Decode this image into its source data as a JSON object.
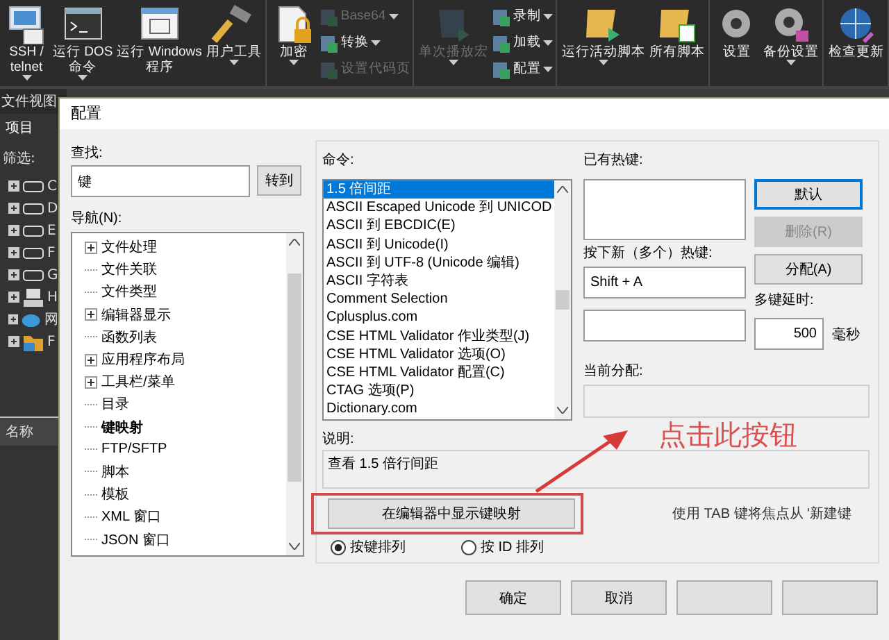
{
  "toolbar": {
    "groups": [
      {
        "items": [
          {
            "kind": "large",
            "label": "SSH /\ntelnet",
            "dropdown": true,
            "disabled": false
          },
          {
            "kind": "large",
            "label": "运行 DOS\n命令",
            "dropdown": true,
            "disabled": false
          },
          {
            "kind": "large",
            "label": "运行 Windows\n程序",
            "dropdown": false,
            "disabled": false
          },
          {
            "kind": "large",
            "label": "用户工具",
            "dropdown": true,
            "disabled": false
          }
        ]
      },
      {
        "items": [
          {
            "kind": "large",
            "label": "加密",
            "dropdown": true,
            "disabled": false
          },
          {
            "kind": "small",
            "label": "Base64",
            "dropdown": true,
            "disabled": true
          },
          {
            "kind": "small",
            "label": "转换",
            "dropdown": true,
            "disabled": false
          },
          {
            "kind": "small",
            "label": "设置代码页",
            "dropdown": false,
            "disabled": true
          }
        ]
      },
      {
        "items": [
          {
            "kind": "large",
            "label": "单次播放宏",
            "dropdown": true,
            "disabled": true
          },
          {
            "kind": "small",
            "label": "录制",
            "dropdown": true,
            "disabled": false
          },
          {
            "kind": "small",
            "label": "加载",
            "dropdown": true,
            "disabled": false
          },
          {
            "kind": "small",
            "label": "配置",
            "dropdown": true,
            "disabled": false
          }
        ]
      },
      {
        "items": [
          {
            "kind": "large",
            "label": "运行活动脚本",
            "dropdown": true,
            "disabled": false
          },
          {
            "kind": "large",
            "label": "所有脚本",
            "dropdown": false,
            "disabled": false
          }
        ]
      },
      {
        "items": [
          {
            "kind": "large",
            "label": "设置",
            "dropdown": false,
            "disabled": false
          },
          {
            "kind": "large",
            "label": "备份设置",
            "dropdown": true,
            "disabled": false
          }
        ]
      },
      {
        "items": [
          {
            "kind": "large",
            "label": "检查更新",
            "dropdown": false,
            "disabled": false
          }
        ]
      }
    ]
  },
  "file_view": {
    "title": "文件视图",
    "tab": "项目",
    "filter_label": "筛选:",
    "drives": [
      {
        "kind": "drive",
        "label": "C"
      },
      {
        "kind": "drive",
        "label": "D"
      },
      {
        "kind": "drive",
        "label": "E"
      },
      {
        "kind": "drive",
        "label": "F"
      },
      {
        "kind": "drive",
        "label": "G"
      },
      {
        "kind": "network",
        "label": "H"
      },
      {
        "kind": "cloud",
        "label": "网"
      },
      {
        "kind": "folder",
        "label": "F"
      }
    ],
    "column_header": "名称"
  },
  "dialog": {
    "title": "配置",
    "find": {
      "label": "查找:",
      "value": "键",
      "button": "转到"
    },
    "nav": {
      "label": "导航(N):",
      "items": [
        {
          "label": "文件处理",
          "expandable": true,
          "selected": false
        },
        {
          "label": "文件关联",
          "expandable": false,
          "selected": false
        },
        {
          "label": "文件类型",
          "expandable": false,
          "selected": false
        },
        {
          "label": "编辑器显示",
          "expandable": true,
          "selected": false
        },
        {
          "label": "函数列表",
          "expandable": false,
          "selected": false
        },
        {
          "label": "应用程序布局",
          "expandable": true,
          "selected": false
        },
        {
          "label": "工具栏/菜单",
          "expandable": true,
          "selected": false
        },
        {
          "label": "目录",
          "expandable": false,
          "selected": false
        },
        {
          "label": "键映射",
          "expandable": false,
          "selected": true
        },
        {
          "label": "FTP/SFTP",
          "expandable": false,
          "selected": false
        },
        {
          "label": "脚本",
          "expandable": false,
          "selected": false
        },
        {
          "label": "模板",
          "expandable": false,
          "selected": false
        },
        {
          "label": "XML 窗口",
          "expandable": false,
          "selected": false
        },
        {
          "label": "JSON 窗口",
          "expandable": false,
          "selected": false
        }
      ]
    },
    "commands": {
      "label": "命令:",
      "items": [
        {
          "label": "1.5 倍间距",
          "selected": true
        },
        {
          "label": "ASCII Escaped Unicode 到 UNICOD",
          "selected": false
        },
        {
          "label": "ASCII 到 EBCDIC(E)",
          "selected": false
        },
        {
          "label": "ASCII 到 Unicode(I)",
          "selected": false
        },
        {
          "label": "ASCII 到 UTF-8 (Unicode 编辑)",
          "selected": false
        },
        {
          "label": "ASCII 字符表",
          "selected": false
        },
        {
          "label": "Comment Selection",
          "selected": false
        },
        {
          "label": "Cplusplus.com",
          "selected": false
        },
        {
          "label": "CSE HTML Validator 作业类型(J)",
          "selected": false
        },
        {
          "label": "CSE HTML Validator 选项(O)",
          "selected": false
        },
        {
          "label": "CSE HTML Validator 配置(C)",
          "selected": false
        },
        {
          "label": "CTAG 选项(P)",
          "selected": false
        },
        {
          "label": "Dictionary.com",
          "selected": false
        }
      ]
    },
    "existing_label": "已有热键:",
    "buttons_side": [
      {
        "label": "默认",
        "disabled": false,
        "focused": true
      },
      {
        "label": "删除(R)",
        "disabled": true,
        "focused": false
      },
      {
        "label": "分配(A)",
        "disabled": false,
        "focused": false
      }
    ],
    "new_hotkey": {
      "label": "按下新（多个）热键:",
      "value": "Shift + A"
    },
    "delay": {
      "label": "多键延时:",
      "value": "500",
      "unit": "毫秒"
    },
    "current_label": "当前分配:",
    "description": {
      "label": "说明:",
      "value": "查看 1.5 倍行间距"
    },
    "show_button": "在编辑器中显示键映射",
    "hint": "使用 TAB 键将焦点从 '新建键",
    "sort": [
      {
        "label": "按键排列",
        "selected": true
      },
      {
        "label": "按 ID 排列",
        "selected": false
      }
    ],
    "footer_buttons": [
      "确定",
      "取消"
    ]
  },
  "annotation": {
    "text": "点击此按钮"
  }
}
